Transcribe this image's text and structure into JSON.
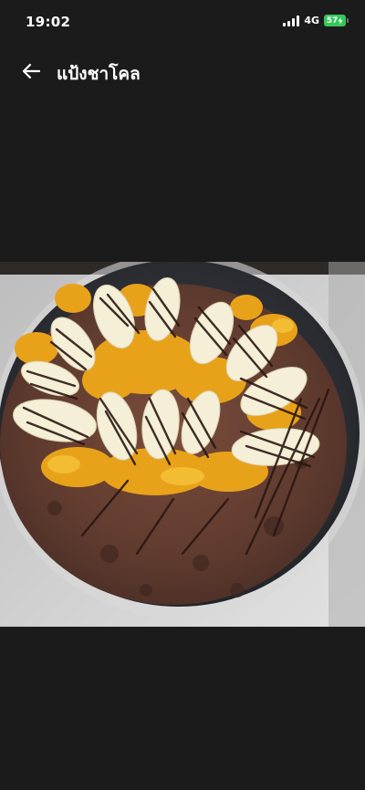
{
  "status_bar": {
    "time": "19:02",
    "network": "4G",
    "battery": "57"
  },
  "header": {
    "title": "แป้งชาโคล",
    "back_icon": "arrow-left-icon"
  },
  "photo": {
    "subject": "food-photo"
  },
  "colors": {
    "background": "#1b1b1b",
    "battery": "#34c759",
    "text": "#ffffff"
  }
}
